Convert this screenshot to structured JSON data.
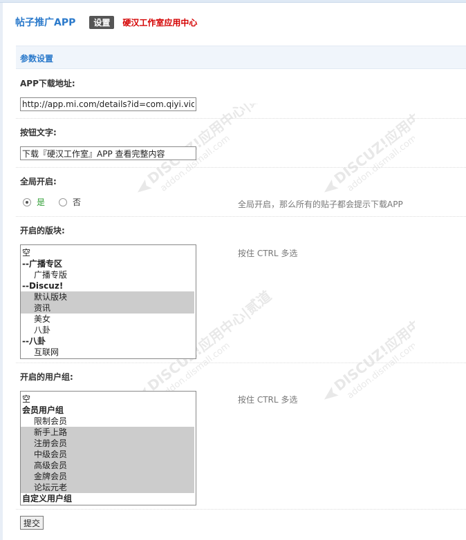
{
  "header": {
    "app_title": "帖子推广APP",
    "settings_tab": "设置",
    "studio_link": "硬汉工作室应用中心"
  },
  "section": {
    "title": "参数设置"
  },
  "fields": {
    "download_url": {
      "label": "APP下载地址:",
      "value": "http://app.mi.com/details?id=com.qiyi.video"
    },
    "button_text": {
      "label": "按钮文字:",
      "value": "下载『硬汉工作室』APP 查看完整内容"
    },
    "global_enable": {
      "label": "全局开启:",
      "options": [
        {
          "label": "是",
          "checked": true
        },
        {
          "label": "否",
          "checked": false
        }
      ],
      "hint": "全局开启，那么所有的贴子都会提示下载APP"
    },
    "forums": {
      "label": "开启的版块:",
      "hint": "按住 CTRL 多选",
      "options": [
        {
          "text": "空",
          "kind": "plain",
          "selected": false
        },
        {
          "text": "--广播专区",
          "kind": "group",
          "selected": false
        },
        {
          "text": "广播专版",
          "kind": "child",
          "selected": false
        },
        {
          "text": "--Discuz!",
          "kind": "group",
          "selected": false
        },
        {
          "text": "默认版块",
          "kind": "child",
          "selected": true
        },
        {
          "text": "资讯",
          "kind": "child",
          "selected": true
        },
        {
          "text": "美女",
          "kind": "child",
          "selected": false
        },
        {
          "text": "八卦",
          "kind": "child",
          "selected": false
        },
        {
          "text": "--八卦",
          "kind": "group",
          "selected": false
        },
        {
          "text": "互联网",
          "kind": "child",
          "selected": false
        }
      ]
    },
    "usergroups": {
      "label": "开启的用户组:",
      "hint": "按住 CTRL 多选",
      "options": [
        {
          "text": "空",
          "kind": "plain",
          "selected": false
        },
        {
          "text": "会员用户组",
          "kind": "group",
          "selected": false
        },
        {
          "text": "限制会员",
          "kind": "child",
          "selected": false
        },
        {
          "text": "新手上路",
          "kind": "child",
          "selected": true
        },
        {
          "text": "注册会员",
          "kind": "child",
          "selected": true
        },
        {
          "text": "中级会员",
          "kind": "child",
          "selected": true
        },
        {
          "text": "高级会员",
          "kind": "child",
          "selected": true
        },
        {
          "text": "金牌会员",
          "kind": "child",
          "selected": true
        },
        {
          "text": "论坛元老",
          "kind": "child",
          "selected": true
        },
        {
          "text": "自定义用户组",
          "kind": "group",
          "selected": false
        }
      ]
    }
  },
  "submit_label": "提交",
  "watermark": {
    "line1": "DISCUZ!应用中心|贰道",
    "line2": "addon.dismall.com"
  },
  "colors": {
    "accent": "#2b7acb",
    "brand_red": "#d40000",
    "yes_green": "#2e9d33",
    "selected_bg": "#cccccc"
  }
}
